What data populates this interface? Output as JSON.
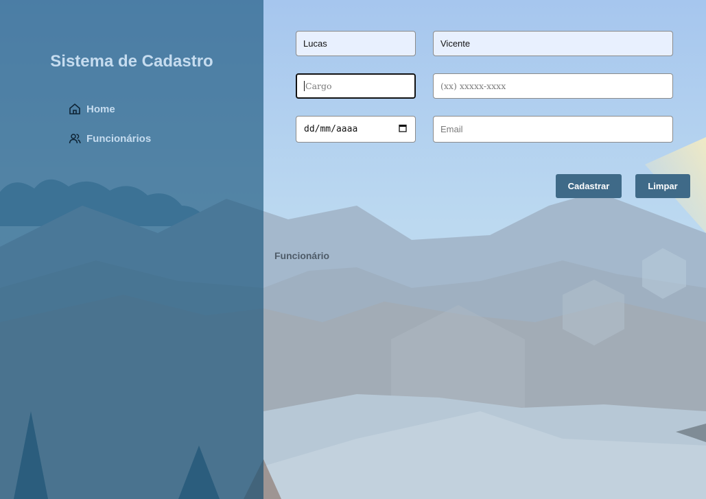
{
  "sidebar": {
    "title": "Sistema de Cadastro",
    "items": [
      {
        "label": "Home",
        "icon": "home-icon"
      },
      {
        "label": "Funcionários",
        "icon": "users-icon"
      }
    ]
  },
  "form": {
    "nome": {
      "value": "Lucas"
    },
    "sobrenome": {
      "value": "Vicente"
    },
    "cargo": {
      "placeholder": "Cargo",
      "value": ""
    },
    "telefone": {
      "placeholder": "(xx) xxxxx-xxxx",
      "value": ""
    },
    "data_nascimento": {
      "placeholder": "dd/mm/aaaa"
    },
    "email": {
      "placeholder": "Email",
      "value": ""
    }
  },
  "buttons": {
    "cadastrar": "Cadastrar",
    "limpar": "Limpar"
  },
  "section": {
    "title": "Funcionário"
  },
  "colors": {
    "sidebar": "#1f5a80",
    "button": "#3f6a88",
    "sidebar_text": "#c6dcef"
  }
}
